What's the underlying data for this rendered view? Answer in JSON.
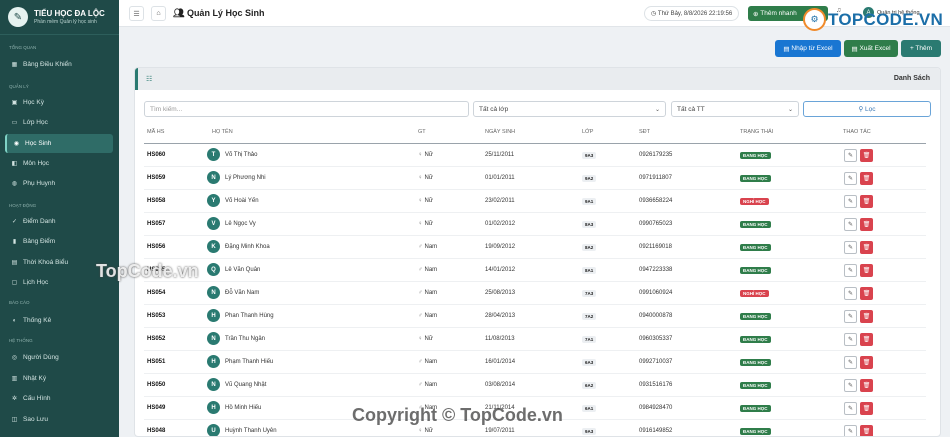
{
  "brand": {
    "title": "TIỂU HỌC ĐA LỘC",
    "subtitle": "Phần mềm Quản lý học sinh"
  },
  "sidebar": {
    "sections": {
      "overview": "TỔNG QUAN",
      "manage": "QUẢN LÝ",
      "activity": "HOẠT ĐỘNG",
      "report": "BÁO CÁO",
      "system": "HỆ THỐNG"
    },
    "items": [
      {
        "label": "Bảng Điều Khiển",
        "icon": "dashboard-icon"
      },
      {
        "label": "Học Kỳ",
        "icon": "calendar-icon"
      },
      {
        "label": "Lớp Học",
        "icon": "classroom-icon"
      },
      {
        "label": "Học Sinh",
        "icon": "students-icon",
        "active": true
      },
      {
        "label": "Môn Học",
        "icon": "book-icon"
      },
      {
        "label": "Phụ Huynh",
        "icon": "parents-icon"
      },
      {
        "label": "Điểm Danh",
        "icon": "check-icon"
      },
      {
        "label": "Bảng Điểm",
        "icon": "chart-icon"
      },
      {
        "label": "Thời Khoá Biểu",
        "icon": "timetable-icon"
      },
      {
        "label": "Lịch Học",
        "icon": "schedule-icon"
      },
      {
        "label": "Thống Kê",
        "icon": "stats-icon"
      },
      {
        "label": "Người Dùng",
        "icon": "users-icon"
      },
      {
        "label": "Nhật Ký",
        "icon": "log-icon"
      },
      {
        "label": "Cấu Hình",
        "icon": "settings-icon"
      },
      {
        "label": "Sao Lưu",
        "icon": "backup-icon"
      }
    ]
  },
  "topbar": {
    "title": "Quản Lý Học Sinh",
    "datetime": "Thứ Bảy, 8/8/2026 22:19:56",
    "quick_add": "Thêm nhanh",
    "user": "Quản trị hệ thống",
    "user_initial": "A"
  },
  "watermark": {
    "logo": "TOPCODE.VN",
    "footer": "Copyright © TopCode.vn",
    "overlay": "TopCode.vn"
  },
  "actions": {
    "import": "Nhập từ Excel",
    "export": "Xuất Excel",
    "add": "+ Thêm"
  },
  "card": {
    "title": "Danh Sách"
  },
  "filters": {
    "search_placeholder": "Tìm kiếm...",
    "class": "Tất cả lớp",
    "status": "Tất cả TT",
    "button": "Lọc"
  },
  "table": {
    "headers": [
      "MÃ HS",
      "HỌ TÊN",
      "GT",
      "NGÀY SINH",
      "LỚP",
      "SĐT",
      "TRẠNG THÁI",
      "THAO TÁC"
    ],
    "rows": [
      {
        "id": "HS060",
        "initial": "T",
        "name": "Võ Thị Thảo",
        "gender": "Nữ",
        "dob": "25/11/2011",
        "cls": "9A3",
        "phone": "0926179235",
        "status": "ĐANG HỌC",
        "active": true
      },
      {
        "id": "HS059",
        "initial": "N",
        "name": "Lý Phương Nhi",
        "gender": "Nữ",
        "dob": "01/01/2011",
        "cls": "9A2",
        "phone": "0971911807",
        "status": "ĐANG HỌC",
        "active": true
      },
      {
        "id": "HS058",
        "initial": "Y",
        "name": "Võ Hoài Yến",
        "gender": "Nữ",
        "dob": "23/02/2011",
        "cls": "9A1",
        "phone": "0936658224",
        "status": "NGHỈ HỌC",
        "active": false
      },
      {
        "id": "HS057",
        "initial": "V",
        "name": "Lê Ngọc Vy",
        "gender": "Nữ",
        "dob": "01/02/2012",
        "cls": "8A3",
        "phone": "0990765023",
        "status": "ĐANG HỌC",
        "active": true
      },
      {
        "id": "HS056",
        "initial": "K",
        "name": "Đặng Minh Khoa",
        "gender": "Nam",
        "dob": "19/09/2012",
        "cls": "8A2",
        "phone": "0921169018",
        "status": "ĐANG HỌC",
        "active": true
      },
      {
        "id": "HS055",
        "initial": "Q",
        "name": "Lê Văn Quân",
        "gender": "Nam",
        "dob": "14/01/2012",
        "cls": "8A1",
        "phone": "0947223338",
        "status": "ĐANG HỌC",
        "active": true
      },
      {
        "id": "HS054",
        "initial": "N",
        "name": "Đỗ Văn Nam",
        "gender": "Nam",
        "dob": "25/08/2013",
        "cls": "7A3",
        "phone": "0991060924",
        "status": "NGHỈ HỌC",
        "active": false
      },
      {
        "id": "HS053",
        "initial": "H",
        "name": "Phan Thanh Hùng",
        "gender": "Nam",
        "dob": "28/04/2013",
        "cls": "7A2",
        "phone": "0940000878",
        "status": "ĐANG HỌC",
        "active": true
      },
      {
        "id": "HS052",
        "initial": "N",
        "name": "Trần Thu Ngân",
        "gender": "Nữ",
        "dob": "11/08/2013",
        "cls": "7A1",
        "phone": "0960305337",
        "status": "ĐANG HỌC",
        "active": true
      },
      {
        "id": "HS051",
        "initial": "H",
        "name": "Phạm Thanh Hiếu",
        "gender": "Nam",
        "dob": "16/01/2014",
        "cls": "6A3",
        "phone": "0992710037",
        "status": "ĐANG HỌC",
        "active": true
      },
      {
        "id": "HS050",
        "initial": "N",
        "name": "Vũ Quang Nhật",
        "gender": "Nam",
        "dob": "03/08/2014",
        "cls": "6A2",
        "phone": "0931516176",
        "status": "ĐANG HỌC",
        "active": true
      },
      {
        "id": "HS049",
        "initial": "H",
        "name": "Hồ Minh Hiếu",
        "gender": "Nam",
        "dob": "21/11/2014",
        "cls": "6A1",
        "phone": "0984928470",
        "status": "ĐANG HỌC",
        "active": true
      },
      {
        "id": "HS048",
        "initial": "U",
        "name": "Huỳnh Thanh Uyên",
        "gender": "Nữ",
        "dob": "19/07/2011",
        "cls": "9A3",
        "phone": "0916149852",
        "status": "ĐANG HỌC",
        "active": true
      }
    ]
  }
}
